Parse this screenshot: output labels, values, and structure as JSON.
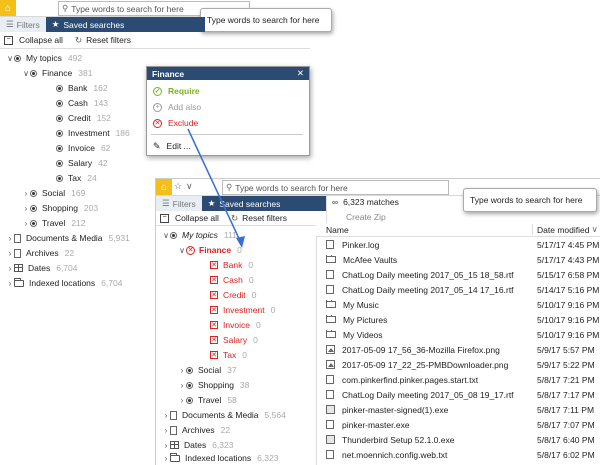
{
  "search": {
    "placeholder": "Type words to search for here",
    "tooltip": "Type words to search for here"
  },
  "tabs": {
    "filters": "Filters",
    "saved_searches": "Saved searches"
  },
  "toolbar": {
    "collapse_all": "Collapse all",
    "reset_filters": "Reset filters"
  },
  "bg_tree": [
    {
      "label": "My topics",
      "count": "492"
    },
    {
      "label": "Finance",
      "count": "381"
    },
    {
      "label": "Bank",
      "count": "162"
    },
    {
      "label": "Cash",
      "count": "143"
    },
    {
      "label": "Credit",
      "count": "152"
    },
    {
      "label": "Investment",
      "count": "186"
    },
    {
      "label": "Invoice",
      "count": "62"
    },
    {
      "label": "Salary",
      "count": "42"
    },
    {
      "label": "Tax",
      "count": "24"
    },
    {
      "label": "Social",
      "count": "169"
    },
    {
      "label": "Shopping",
      "count": "203"
    },
    {
      "label": "Travel",
      "count": "212"
    },
    {
      "label": "Documents & Media",
      "count": "5,931"
    },
    {
      "label": "Archives",
      "count": "22"
    },
    {
      "label": "Dates",
      "count": "6,704"
    },
    {
      "label": "Indexed locations",
      "count": "6,704"
    }
  ],
  "popup": {
    "title": "Finance",
    "close": "✕",
    "require": "Require",
    "add_also": "Add also",
    "exclude": "Exclude",
    "edit": "Edit ..."
  },
  "front": {
    "matches": "6,323 matches",
    "create_zip": "Create Zip",
    "col_name": "Name",
    "col_date": "Date modified",
    "tree": [
      {
        "label": "My topics",
        "count": "111"
      },
      {
        "label": "Finance",
        "count": "0"
      },
      {
        "label": "Bank",
        "count": "0"
      },
      {
        "label": "Cash",
        "count": "0"
      },
      {
        "label": "Credit",
        "count": "0"
      },
      {
        "label": "Investment",
        "count": "0"
      },
      {
        "label": "Invoice",
        "count": "0"
      },
      {
        "label": "Salary",
        "count": "0"
      },
      {
        "label": "Tax",
        "count": "0"
      },
      {
        "label": "Social",
        "count": "37"
      },
      {
        "label": "Shopping",
        "count": "38"
      },
      {
        "label": "Travel",
        "count": "58"
      },
      {
        "label": "Documents & Media",
        "count": "5,564"
      },
      {
        "label": "Archives",
        "count": "22"
      },
      {
        "label": "Dates",
        "count": "6,323"
      },
      {
        "label": "Indexed locations",
        "count": "6,323"
      }
    ],
    "files": [
      {
        "name": "Pinker.log",
        "date": "5/17/17 4:45 PM",
        "icon": "doc"
      },
      {
        "name": "McAfee Vaults",
        "date": "5/17/17 4:43 PM",
        "icon": "folder"
      },
      {
        "name": "ChatLog Daily meeting 2017_05_15 18_58.rtf",
        "date": "5/15/17 6:58 PM",
        "icon": "doc"
      },
      {
        "name": "ChatLog Daily meeting 2017_05_14 17_16.rtf",
        "date": "5/14/17 5:16 PM",
        "icon": "doc"
      },
      {
        "name": "My Music",
        "date": "5/10/17 9:16 PM",
        "icon": "folder"
      },
      {
        "name": "My Pictures",
        "date": "5/10/17 9:16 PM",
        "icon": "folder"
      },
      {
        "name": "My Videos",
        "date": "5/10/17 9:16 PM",
        "icon": "folder"
      },
      {
        "name": "2017-05-09 17_56_36-Mozilla Firefox.png",
        "date": "5/9/17 5:57 PM",
        "icon": "img"
      },
      {
        "name": "2017-05-09 17_22_25-PMBDownloader.png",
        "date": "5/9/17 5:22 PM",
        "icon": "img"
      },
      {
        "name": "com.pinkerfind.pinker.pages.start.txt",
        "date": "5/8/17 7:21 PM",
        "icon": "doc"
      },
      {
        "name": "ChatLog Daily meeting 2017_05_08 19_17.rtf",
        "date": "5/8/17 7:17 PM",
        "icon": "doc"
      },
      {
        "name": "pinker-master-signed(1).exe",
        "date": "5/8/17 7:11 PM",
        "icon": "exe"
      },
      {
        "name": "pinker-master.exe",
        "date": "5/8/17 7:07 PM",
        "icon": "doc"
      },
      {
        "name": "Thunderbird Setup 52.1.0.exe",
        "date": "5/8/17 6:40 PM",
        "icon": "exe"
      },
      {
        "name": "net.moennich.config.web.txt",
        "date": "5/8/17 6:02 PM",
        "icon": "doc"
      }
    ]
  },
  "colors": {
    "accent": "#2b4b73",
    "home": "#f3c019",
    "exclude": "#dd2222",
    "require": "#7ab51d"
  }
}
